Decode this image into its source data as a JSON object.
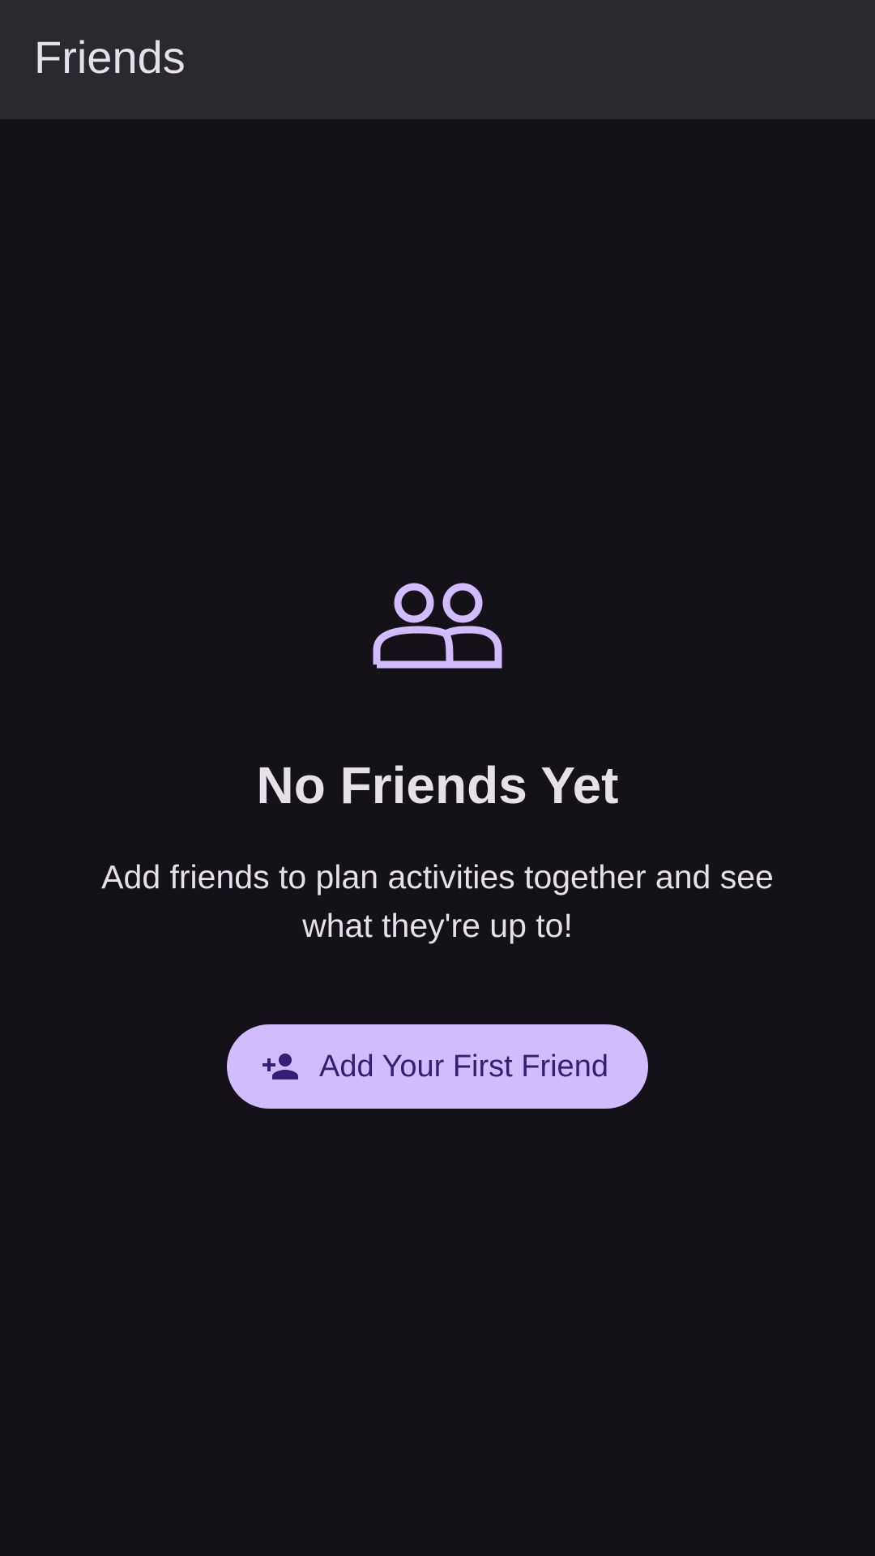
{
  "top_bar": {
    "title": "Friends"
  },
  "empty_state": {
    "icon": "people-outline-icon",
    "title": "No Friends Yet",
    "message": "Add friends to plan activities together and see what they're up to!",
    "button": {
      "icon": "person-add-icon",
      "label": "Add Your First Friend"
    }
  },
  "colors": {
    "background": "#141218",
    "top_bar": "#2b2930",
    "on_surface": "#e6e0e9",
    "primary": "#d0bcff",
    "on_primary": "#381e72"
  }
}
